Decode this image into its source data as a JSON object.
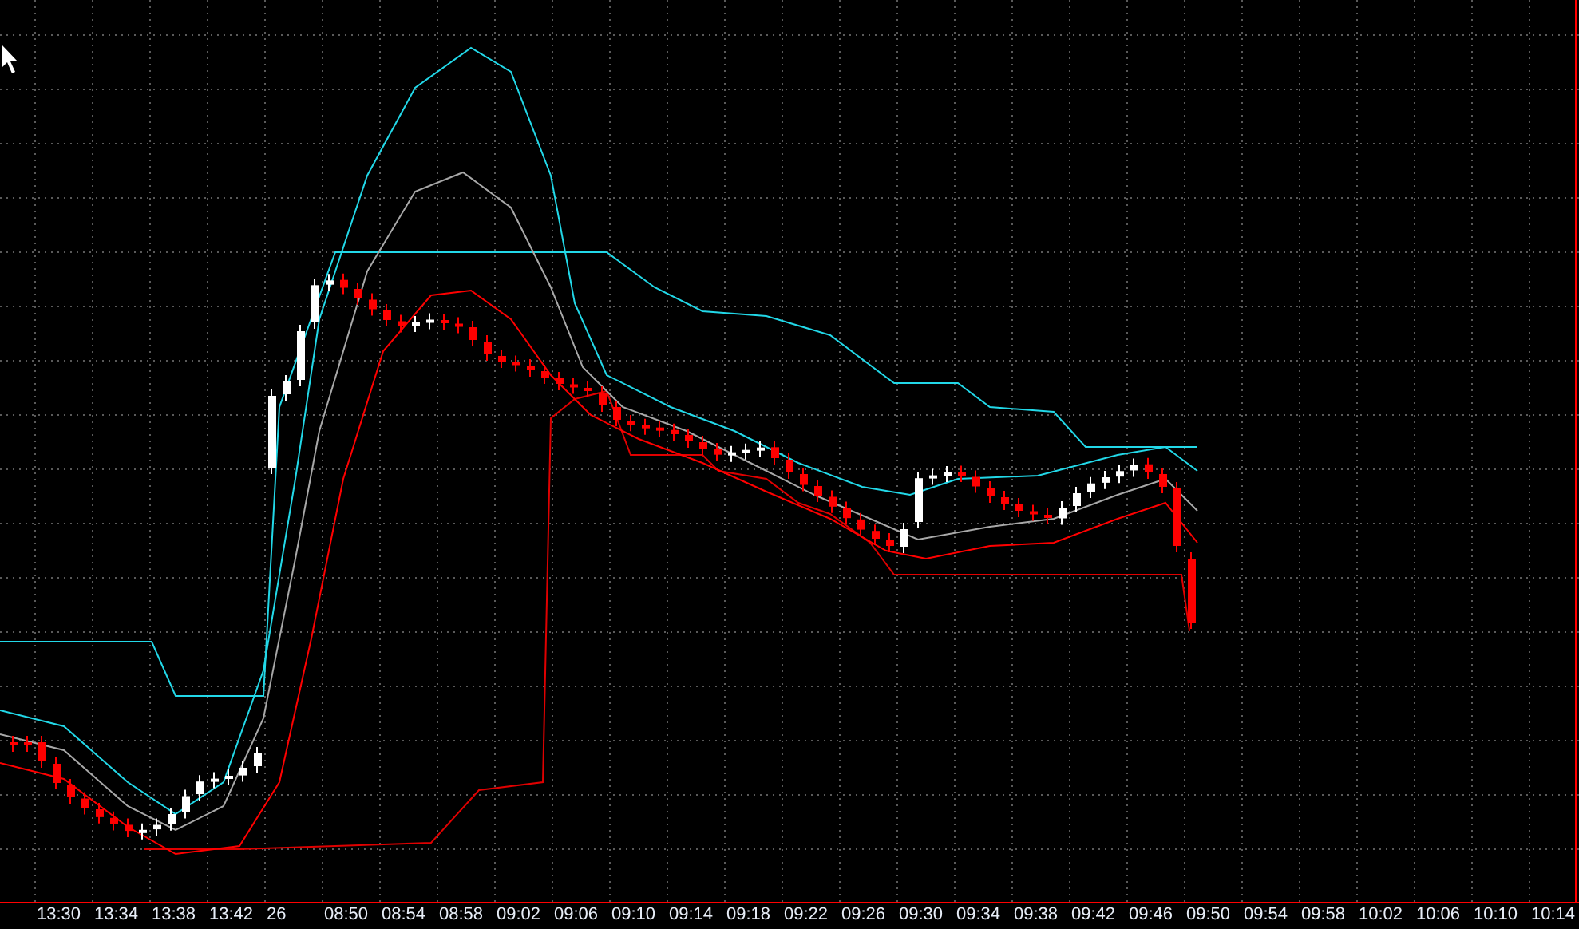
{
  "x_axis": {
    "labels": [
      "13:30",
      "13:34",
      "13:38",
      "13:42",
      "26",
      "08:50",
      "08:54",
      "08:58",
      "09:02",
      "09:06",
      "09:10",
      "09:14",
      "09:18",
      "09:22",
      "09:26",
      "09:30",
      "09:34",
      "09:38",
      "09:42",
      "09:46",
      "09:50",
      "09:54",
      "09:58",
      "10:02",
      "10:06",
      "10:10",
      "10:14"
    ]
  }
}
